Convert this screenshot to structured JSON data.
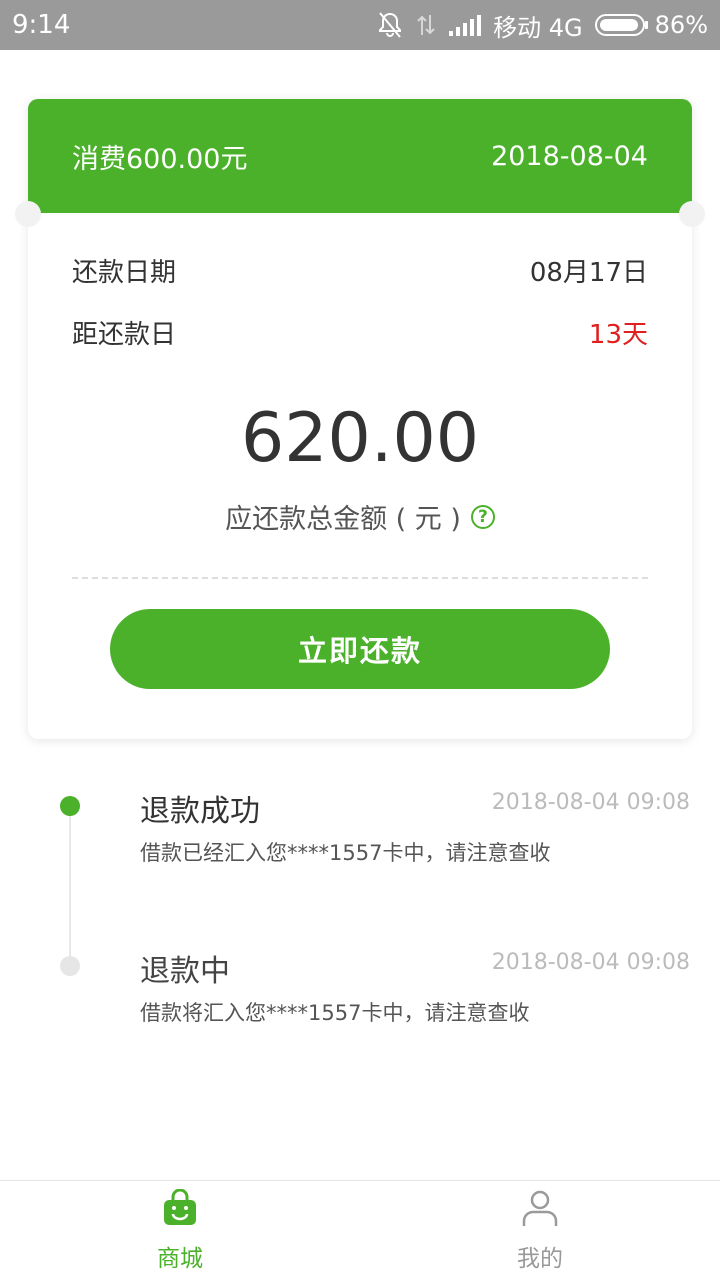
{
  "status_bar": {
    "time": "9:14",
    "carrier": "移动 4G",
    "battery": "86%"
  },
  "card": {
    "header_amount": "消费600.00元",
    "header_date": "2018-08-04",
    "due_label": "还款日期",
    "due_value": "08月17日",
    "days_label": "距还款日",
    "days_value": "13天",
    "total_amount": "620.00",
    "total_label": "应还款总金额 ( 元 )",
    "help_icon": "?",
    "repay_button": "立即还款"
  },
  "timeline": [
    {
      "title": "退款成功",
      "time": "2018-08-04 09:08",
      "desc": "借款已经汇入您****1557卡中，请注意查收"
    },
    {
      "title": "退款中",
      "time": "2018-08-04 09:08",
      "desc": "借款将汇入您****1557卡中，请注意查收"
    }
  ],
  "nav": {
    "mall": "商城",
    "mine": "我的"
  },
  "colors": {
    "accent": "#4bb12a",
    "alert": "#e02020"
  }
}
